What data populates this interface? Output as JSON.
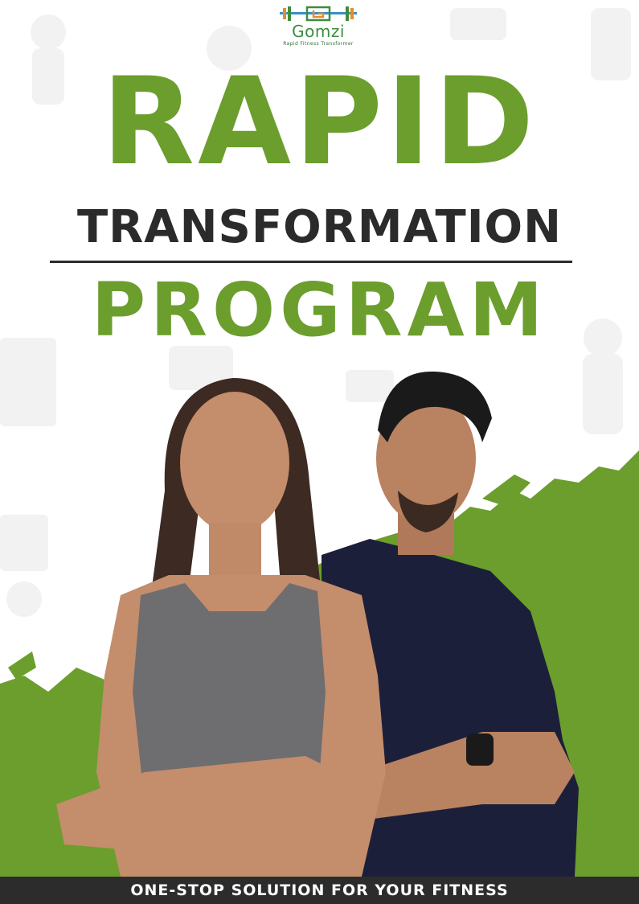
{
  "brand": {
    "name": "Gomzi",
    "tagline": "Rapid Fitness Transformer"
  },
  "headline": {
    "line1": "RAPID",
    "line2": "TRANSFORMATION",
    "line3": "PROGRAM"
  },
  "footer": {
    "text": "ONE-STOP SOLUTION FOR YOUR FITNESS"
  },
  "colors": {
    "accent_green": "#6b9e2d",
    "dark": "#2b2b2b",
    "footer_bg": "#2c2c2c"
  },
  "icons": [
    "dumbbell-icon",
    "fitness-person-icon",
    "kettlebell-icon",
    "scale-icon"
  ]
}
